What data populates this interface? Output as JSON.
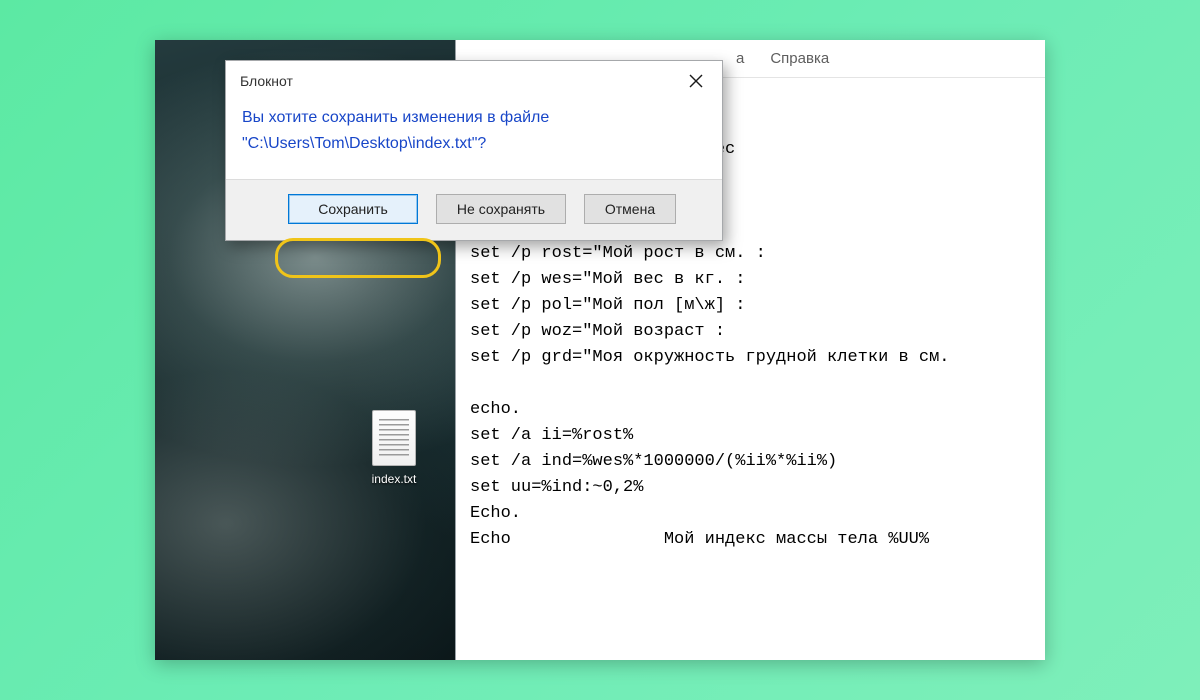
{
  "desktop": {
    "file_icon_label": "index.txt"
  },
  "notepad": {
    "menu": {
      "item_a": "а",
      "item_help": "Справка"
    },
    "content": "expansion\n\nассы тела и идеального вес\ns=26\necho.\necho.\nset /p rost=\"Мой рост в см. :\nset /p wes=\"Мой вес в кг. :\nset /p pol=\"Мой пол [м\\ж] :\nset /p woz=\"Мой возраст :\nset /p grd=\"Моя окружность грудной клетки в см.\n\necho.\nset /a ii=%rost%\nset /a ind=%wes%*1000000/(%ii%*%ii%)\nset uu=%ind:~0,2%\nEcho.\nEcho               Мой индекс массы тела %UU%"
  },
  "dialog": {
    "title": "Блокнот",
    "message_line1": "Вы хотите сохранить изменения в файле",
    "message_line2": "\"C:\\Users\\Tom\\Desktop\\index.txt\"?",
    "buttons": {
      "save": "Сохранить",
      "dont_save": "Не сохранять",
      "cancel": "Отмена"
    }
  }
}
